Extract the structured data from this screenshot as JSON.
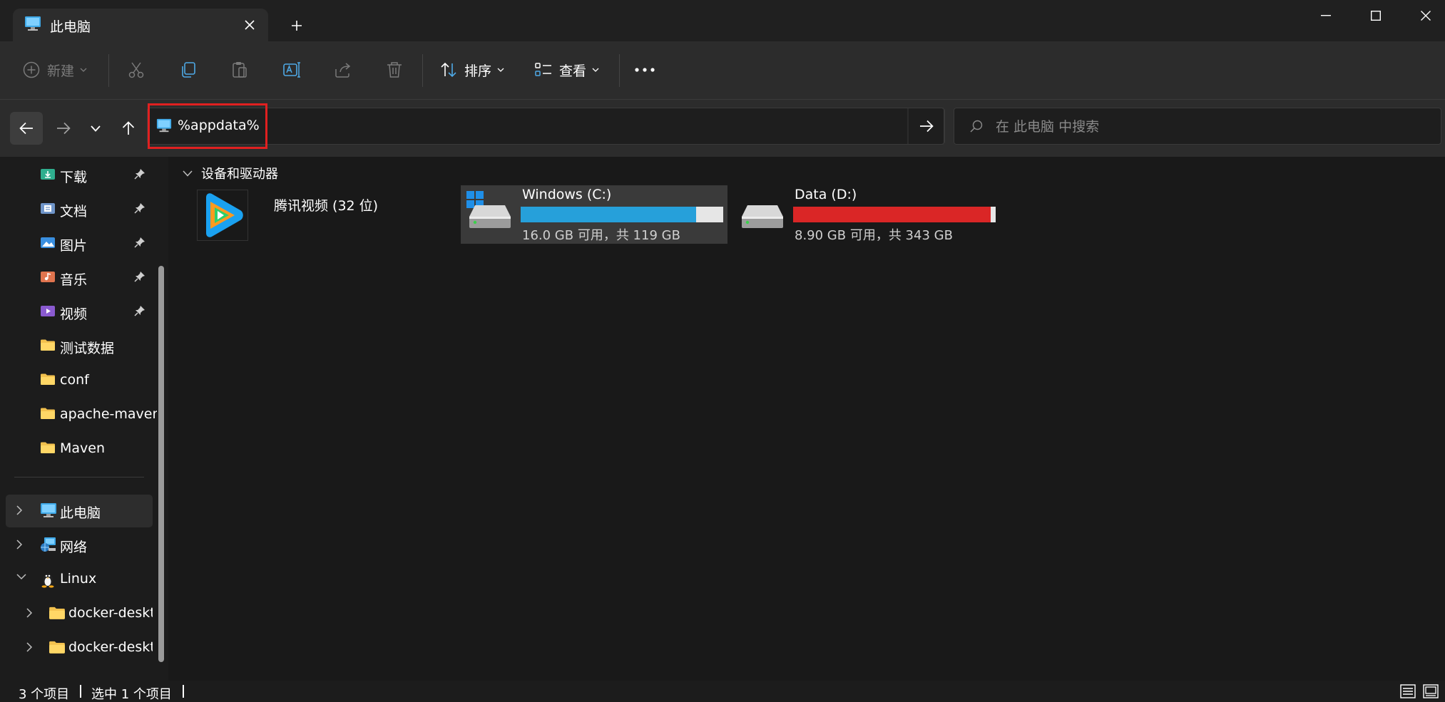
{
  "window": {
    "tab_title": "此电脑",
    "tab_icon": "computer-icon",
    "controls": [
      "minimize-icon",
      "maximize-icon",
      "close-icon"
    ]
  },
  "commandbar": {
    "new_label": "新建",
    "sort_label": "排序",
    "view_label": "查看",
    "more_icon": "more-icon"
  },
  "address": {
    "value": "%appdata%",
    "highlight_color": "#e02020"
  },
  "search": {
    "placeholder": "在 此电脑 中搜索"
  },
  "sidebar": {
    "quick_access": [
      {
        "label": "下载",
        "icon": "download-folder-icon",
        "pinned": true
      },
      {
        "label": "文档",
        "icon": "documents-folder-icon",
        "pinned": true
      },
      {
        "label": "图片",
        "icon": "pictures-folder-icon",
        "pinned": true
      },
      {
        "label": "音乐",
        "icon": "music-folder-icon",
        "pinned": true
      },
      {
        "label": "视频",
        "icon": "videos-folder-icon",
        "pinned": true
      },
      {
        "label": "测试数据",
        "icon": "folder-icon"
      },
      {
        "label": "conf",
        "icon": "folder-icon"
      },
      {
        "label": "apache-maven",
        "icon": "folder-icon"
      },
      {
        "label": "Maven",
        "icon": "folder-icon"
      }
    ],
    "tree": [
      {
        "label": "此电脑",
        "icon": "computer-icon",
        "expanded": false,
        "selected": true
      },
      {
        "label": "网络",
        "icon": "network-icon",
        "expanded": false
      },
      {
        "label": "Linux",
        "icon": "linux-penguin-icon",
        "expanded": true
      },
      {
        "label": "docker-deskto",
        "icon": "folder-icon",
        "expanded": false
      },
      {
        "label": "docker-deskto",
        "icon": "folder-icon",
        "expanded": false
      }
    ]
  },
  "main": {
    "group_label": "设备和驱动器",
    "items": [
      {
        "name": "腾讯视频 (32 位)",
        "icon": "tencent-video-icon"
      },
      {
        "name": "Windows (C:)",
        "info": "16.0 GB 可用，共 119 GB",
        "used_fraction": 0.866,
        "bar_color": "#26a0da",
        "icon": "windows-drive-icon",
        "selected": true
      },
      {
        "name": "Data (D:)",
        "info": "8.90 GB 可用，共 343 GB",
        "used_fraction": 0.974,
        "bar_color": "#da2626",
        "icon": "drive-icon"
      }
    ]
  },
  "status": {
    "item_count": "3 个项目",
    "selected_count": "选中 1 个项目"
  }
}
